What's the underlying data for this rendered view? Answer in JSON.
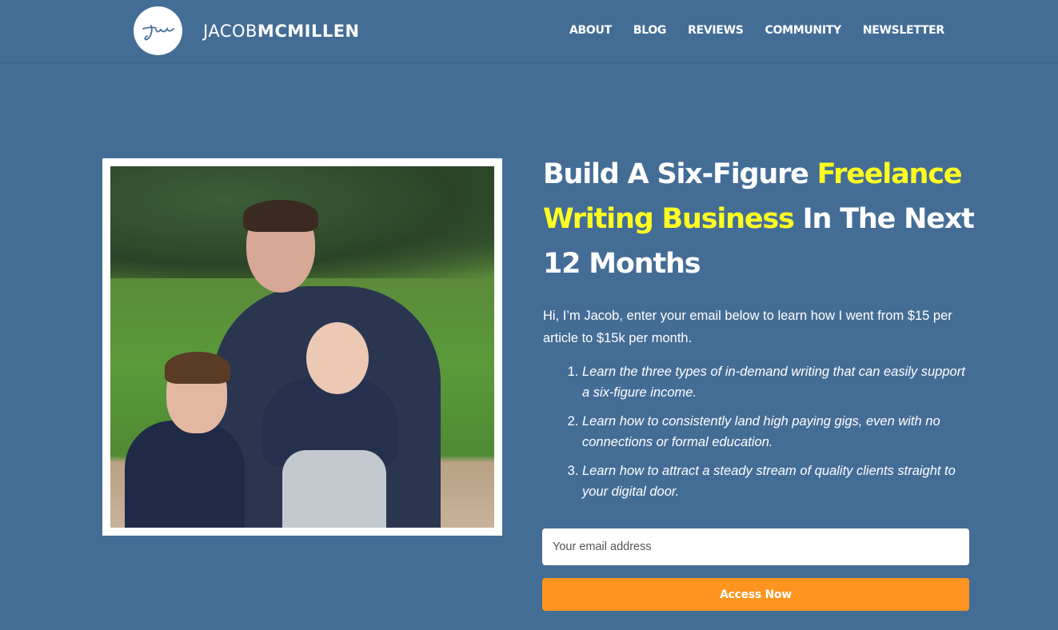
{
  "brand": {
    "logo_monogram": "jm",
    "name_light": "JACOB",
    "name_bold": "MCMILLEN"
  },
  "nav": {
    "items": [
      {
        "label": "ABOUT"
      },
      {
        "label": "BLOG"
      },
      {
        "label": "REVIEWS"
      },
      {
        "label": "COMMUNITY"
      },
      {
        "label": "NEWSLETTER"
      }
    ]
  },
  "hero": {
    "photo_alt": "Jacob with his two young sons sitting on a bench in a park",
    "headline": {
      "part1": "Build A Six-Figure ",
      "highlight1": "Freelance Writing Business",
      "part2": " In The Next 12 Months"
    },
    "intro": "Hi, I’m Jacob, enter your email below to learn how I went from $15 per article to $15k per month.",
    "benefits": [
      "Learn the three types of in-demand writing that can easily support a six-figure income.",
      "Learn how to consistently land high paying gigs, even with no connections or formal education.",
      "Learn how to attract a steady stream of quality clients straight to your digital door."
    ]
  },
  "form": {
    "email_placeholder": "Your email address",
    "email_value": "",
    "submit_label": "Access Now"
  },
  "colors": {
    "background": "#446d96",
    "highlight": "#ffff22",
    "cta": "#ff9420"
  }
}
